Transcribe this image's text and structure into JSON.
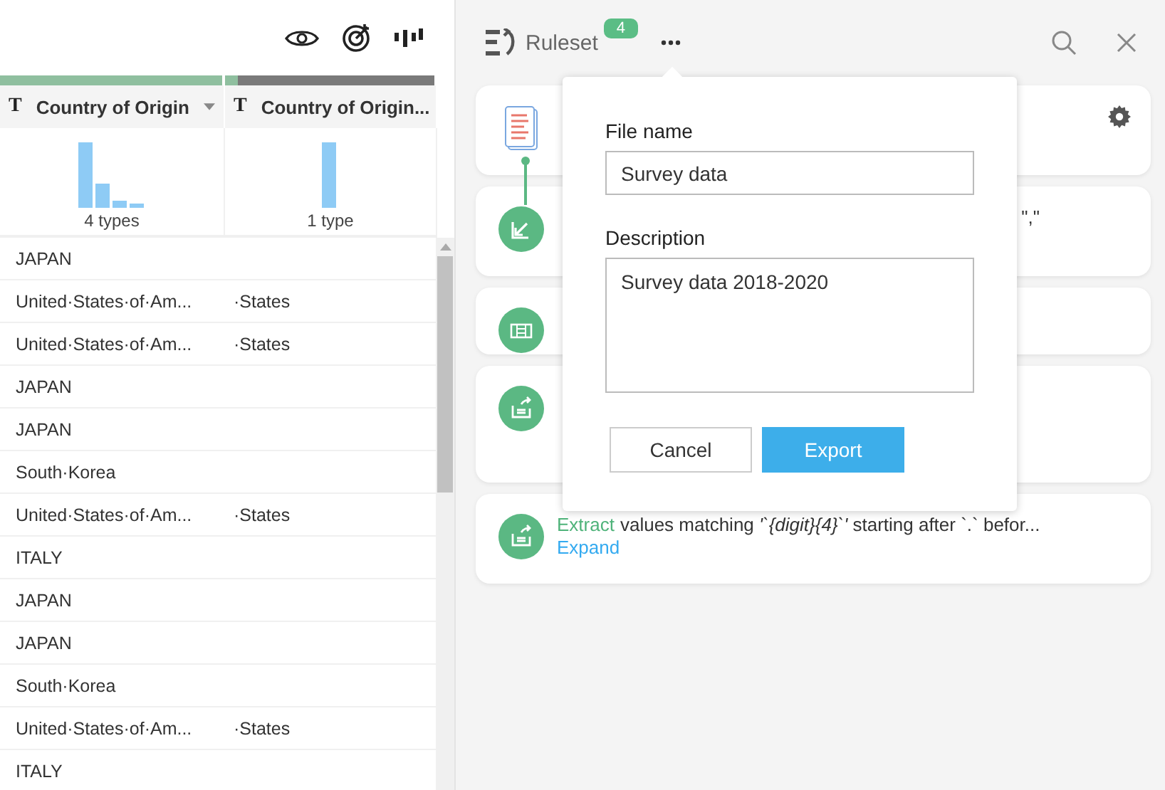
{
  "grid": {
    "columns": [
      {
        "type": "T",
        "title": "Country of Origin",
        "has_menu": true,
        "quality": {
          "level": 1
        },
        "summary": "4 types"
      },
      {
        "type": "T",
        "title": "Country of Origin...",
        "has_menu": false,
        "quality": {
          "level": 0.06
        },
        "summary": "1 type"
      }
    ],
    "rows": [
      [
        "JAPAN",
        ""
      ],
      [
        "United·States·of·Am...",
        "·States"
      ],
      [
        "United·States·of·Am...",
        "·States"
      ],
      [
        "JAPAN",
        ""
      ],
      [
        "JAPAN",
        ""
      ],
      [
        "South·Korea",
        ""
      ],
      [
        "United·States·of·Am...",
        "·States"
      ],
      [
        "ITALY",
        ""
      ],
      [
        "JAPAN",
        ""
      ],
      [
        "JAPAN",
        ""
      ],
      [
        "South·Korea",
        ""
      ],
      [
        "United·States·of·Am...",
        "·States"
      ],
      [
        "ITALY",
        ""
      ]
    ]
  },
  "ruleset": {
    "title": "Ruleset",
    "count": "4",
    "rules": [
      {
        "kind": "source"
      },
      {
        "kind": "import",
        "tail": "\",\""
      },
      {
        "kind": "table"
      },
      {
        "kind": "extract"
      },
      {
        "kind": "extract",
        "action": "Extract",
        "text": "values matching *'`{digit}{4}`'* starting after `.` befor...",
        "link": "Expand"
      }
    ]
  },
  "export_popup": {
    "file_name_label": "File name",
    "file_name": "Survey data",
    "description_label": "Description",
    "description": "Survey data 2018-2020",
    "buttons": [
      {
        "kind": "secondary",
        "label": "Cancel"
      },
      {
        "kind": "primary",
        "label": "Export"
      }
    ]
  }
}
